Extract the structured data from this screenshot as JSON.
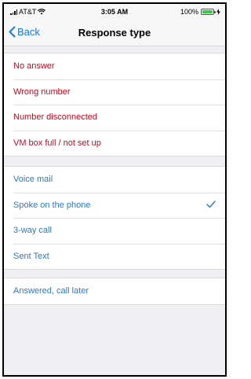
{
  "status_bar": {
    "carrier": "AT&T",
    "time": "3:05 AM",
    "battery": "100%"
  },
  "nav": {
    "back_label": "Back",
    "title": "Response type"
  },
  "groups": [
    {
      "items": [
        {
          "label": "No answer",
          "color": "#d0021b"
        },
        {
          "label": "Wrong number",
          "color": "#d0021b"
        },
        {
          "label": "Number disconnected",
          "color": "#d0021b"
        },
        {
          "label": "VM box full / not set up",
          "color": "#d0021b"
        }
      ]
    },
    {
      "items": [
        {
          "label": "Voice mail",
          "color": "#2f78c4"
        },
        {
          "label": "Spoke on the phone",
          "color": "#2f78c4",
          "selected": true
        },
        {
          "label": "3-way call",
          "color": "#2f78c4"
        },
        {
          "label": "Sent Text",
          "color": "#2f78c4"
        }
      ]
    },
    {
      "items": [
        {
          "label": "Answered, call later",
          "color": "#2f78c4"
        }
      ]
    }
  ],
  "icons": {
    "back": "chevron-left-icon",
    "selected": "checkmark-icon",
    "signal": "signal-bars-icon",
    "wifi": "wifi-icon",
    "battery": "battery-icon"
  }
}
